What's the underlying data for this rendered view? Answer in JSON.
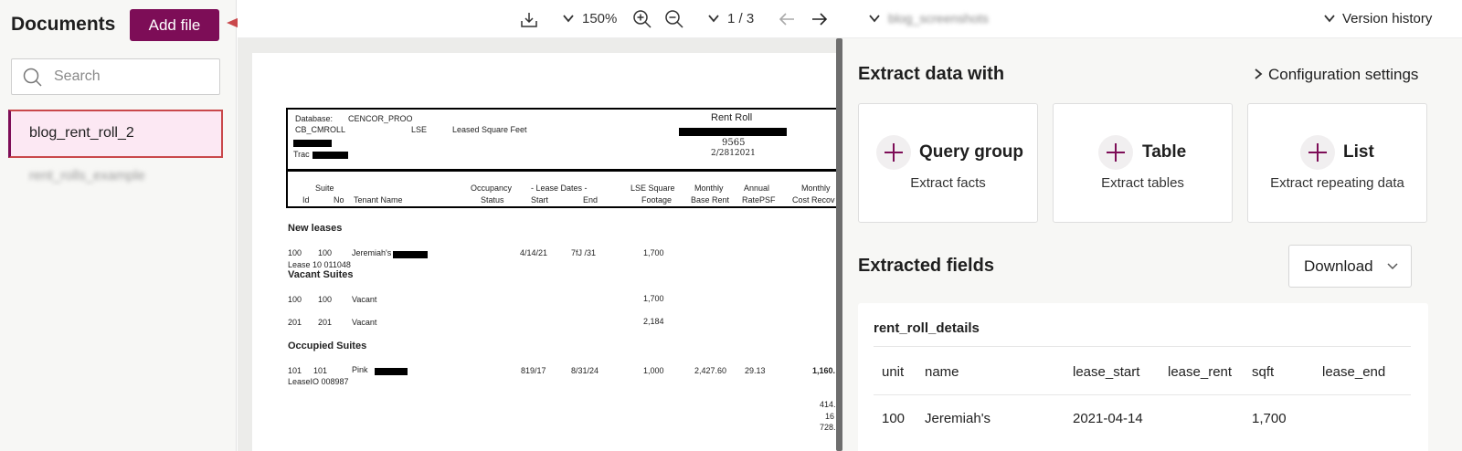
{
  "sidebar": {
    "title": "Documents",
    "add_button": "Add file",
    "search_placeholder": "Search",
    "documents": [
      "blog_rent_roll_2",
      "rent_rolls_example"
    ]
  },
  "viewer_toolbar": {
    "zoom": "150%",
    "page_indicator": "1 / 3"
  },
  "right_header": {
    "folder_name": "blog_screenshots",
    "version_history": "Version history"
  },
  "document_preview": {
    "database_label": "Database:",
    "database_value": "CENCOR_PROO",
    "report_code": "CB_CMROLL",
    "lse": "LSE",
    "leased_sqft": "Leased Square Feet",
    "report_title": "Rent Roll",
    "report_number": "9565",
    "report_date": "2/2812021",
    "trac_label": "Trac",
    "col_suite": "Suite",
    "col_id": "Id",
    "col_no": "No",
    "col_tenant": "Tenant Name",
    "col_occupancy": "Occupancy",
    "col_status": "Status",
    "col_lease_dates": "- Lease Dates -",
    "col_start": "Start",
    "col_end": "End",
    "col_lse_square": "LSE Square",
    "col_footage": "Footage",
    "col_monthly": "Monthly",
    "col_base_rent": "Base Rent",
    "col_annual": "Annual",
    "col_rate_psf": "RatePSF",
    "col_monthly2": "Monthly",
    "col_cost_recov": "Cost Recov",
    "section_new": "New leases",
    "new_id": "100",
    "new_no": "100",
    "new_tenant": "Jeremiah's",
    "new_start": "4/14/21",
    "new_end": "7fJ  /31",
    "new_footage": "1,700",
    "new_lease": "Lease 10  011048",
    "section_vacant": "Vacant Suites",
    "vac1_id": "100",
    "vac1_no": "100",
    "vac1_tenant": "Vacant",
    "vac1_footage": "1,700",
    "vac2_id": "201",
    "vac2_no": "201",
    "vac2_tenant": "Vacant",
    "vac2_footage": "2,184",
    "section_occupied": "Occupied Suites",
    "occ_id": "101",
    "occ_no": "101",
    "occ_tenant": "Pink",
    "occ_start": "819/17",
    "occ_end": "8/31/24",
    "occ_footage": "1,000",
    "occ_rent": "2,427.60",
    "occ_rate": "29.13",
    "occ_recov": "1,160.",
    "occ_lease": "LeaseIO  008987",
    "frag1": "414.",
    "frag2": "16",
    "frag3": "728."
  },
  "extract": {
    "title": "Extract data with",
    "config_link": "Configuration settings",
    "cards": [
      {
        "title": "Query group",
        "subtitle": "Extract facts"
      },
      {
        "title": "Table",
        "subtitle": "Extract tables"
      },
      {
        "title": "List",
        "subtitle": "Extract repeating data"
      }
    ]
  },
  "extracted": {
    "title": "Extracted fields",
    "download": "Download",
    "table_name": "rent_roll_details",
    "columns": [
      "unit",
      "name",
      "lease_start",
      "lease_rent",
      "sqft",
      "lease_end"
    ],
    "rows": [
      [
        "100",
        "Jeremiah's",
        "2021-04-14",
        "",
        "1,700",
        ""
      ]
    ]
  },
  "colors": {
    "accent": "#7d0d57",
    "selected_bg": "#fce8f3",
    "annotation_red": "#c9484b"
  }
}
